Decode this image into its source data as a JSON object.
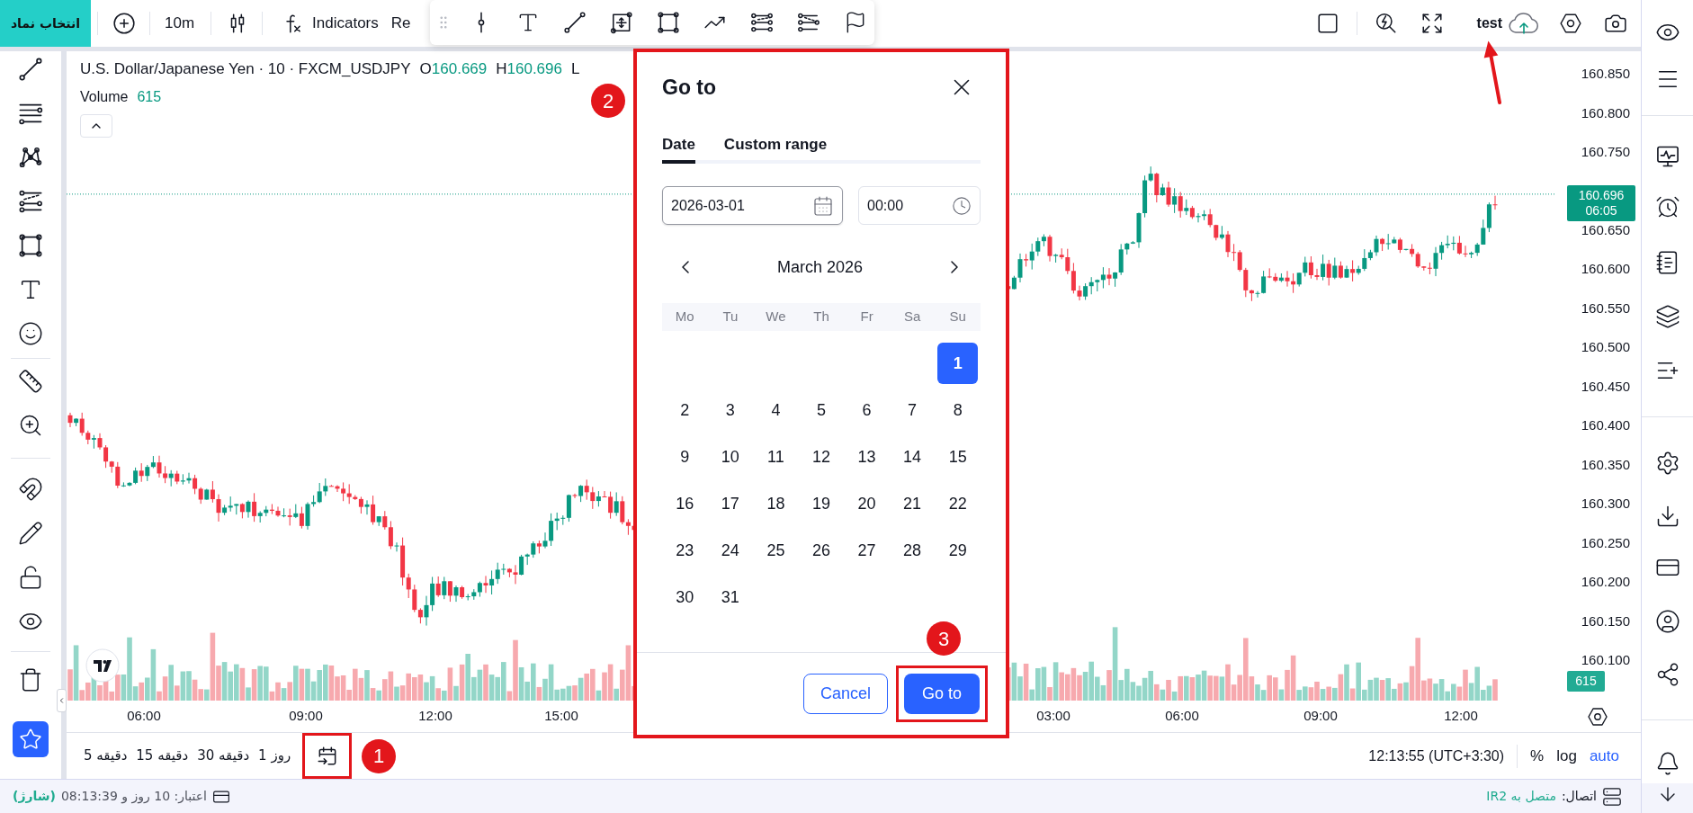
{
  "top_bar": {
    "symbol_button": "انتخاب نماد",
    "interval": "10m",
    "indicators": "Indicators",
    "partial_button": "Re",
    "account": "test"
  },
  "chart": {
    "title": "U.S. Dollar/Japanese Yen · 10 · FXCM_USDJPY",
    "ohlc": [
      {
        "letter": "O",
        "value": "160.669"
      },
      {
        "letter": "H",
        "value": "160.696"
      },
      {
        "letter": "L"
      }
    ],
    "volume": {
      "label": "Volume",
      "value": "615"
    }
  },
  "price_axis": {
    "labels": [
      "160.850",
      "160.800",
      "160.750",
      "160.650",
      "160.600",
      "160.550",
      "160.500",
      "160.450",
      "160.400",
      "160.350",
      "160.300",
      "160.250",
      "160.200",
      "160.150",
      "160.100"
    ],
    "last_price": "160.696",
    "countdown": "06:05",
    "volume_tag": "615"
  },
  "time_axis": {
    "labels": [
      "06:00",
      "09:00",
      "12:00",
      "15:00",
      "03:00",
      "06:00",
      "09:00",
      "12:00"
    ]
  },
  "dialog": {
    "title": "Go to",
    "tabs": [
      {
        "label": "Date",
        "selected": true
      },
      {
        "label": "Custom range",
        "selected": false
      }
    ],
    "date_value": "2026-03-01",
    "time_value": "00:00",
    "month": "March 2026",
    "weekdays": [
      "Mo",
      "Tu",
      "We",
      "Th",
      "Fr",
      "Sa",
      "Su"
    ],
    "weeks": [
      [
        {
          "label": "1",
          "selected": true
        }
      ],
      [
        {
          "label": "2",
          "selected": false
        },
        {
          "label": "3",
          "selected": false
        },
        {
          "label": "4",
          "selected": false
        },
        {
          "label": "5",
          "selected": false
        },
        {
          "label": "6",
          "selected": false
        },
        {
          "label": "7",
          "selected": false
        },
        {
          "label": "8",
          "selected": false
        }
      ],
      [
        {
          "label": "9",
          "selected": false
        },
        {
          "label": "10",
          "selected": false
        },
        {
          "label": "11",
          "selected": false
        },
        {
          "label": "12",
          "selected": false
        },
        {
          "label": "13",
          "selected": false
        },
        {
          "label": "14",
          "selected": false
        },
        {
          "label": "15",
          "selected": false
        }
      ],
      [
        {
          "label": "16",
          "selected": false
        },
        {
          "label": "17",
          "selected": false
        },
        {
          "label": "18",
          "selected": false
        },
        {
          "label": "19",
          "selected": false
        },
        {
          "label": "20",
          "selected": false
        },
        {
          "label": "21",
          "selected": false
        },
        {
          "label": "22",
          "selected": false
        }
      ],
      [
        {
          "label": "23",
          "selected": false
        },
        {
          "label": "24",
          "selected": false
        },
        {
          "label": "25",
          "selected": false
        },
        {
          "label": "26",
          "selected": false
        },
        {
          "label": "27",
          "selected": false
        },
        {
          "label": "28",
          "selected": false
        },
        {
          "label": "29",
          "selected": false
        }
      ],
      [
        {
          "label": "30",
          "selected": false
        },
        {
          "label": "31",
          "selected": false
        }
      ]
    ],
    "cancel": "Cancel",
    "confirm": "Go to"
  },
  "bottom_toolbar": {
    "intervals": [
      "1 روز",
      "30 دقیقه",
      "15 دقیقه",
      "5 دقیقه"
    ],
    "clock": "12:13:55 (UTC+3:30)",
    "scale_buttons": [
      {
        "label": "%",
        "selected": false
      },
      {
        "label": "log",
        "selected": false
      },
      {
        "label": "auto",
        "selected": true
      }
    ]
  },
  "status_bar": {
    "credit": "اعتبار: 10 روز و 08:13:39",
    "credit_note": "(شارژ)",
    "connection_label": "اتصال:",
    "connection_value": "متصل به IR2"
  },
  "callouts": [
    "1",
    "2",
    "3"
  ]
}
